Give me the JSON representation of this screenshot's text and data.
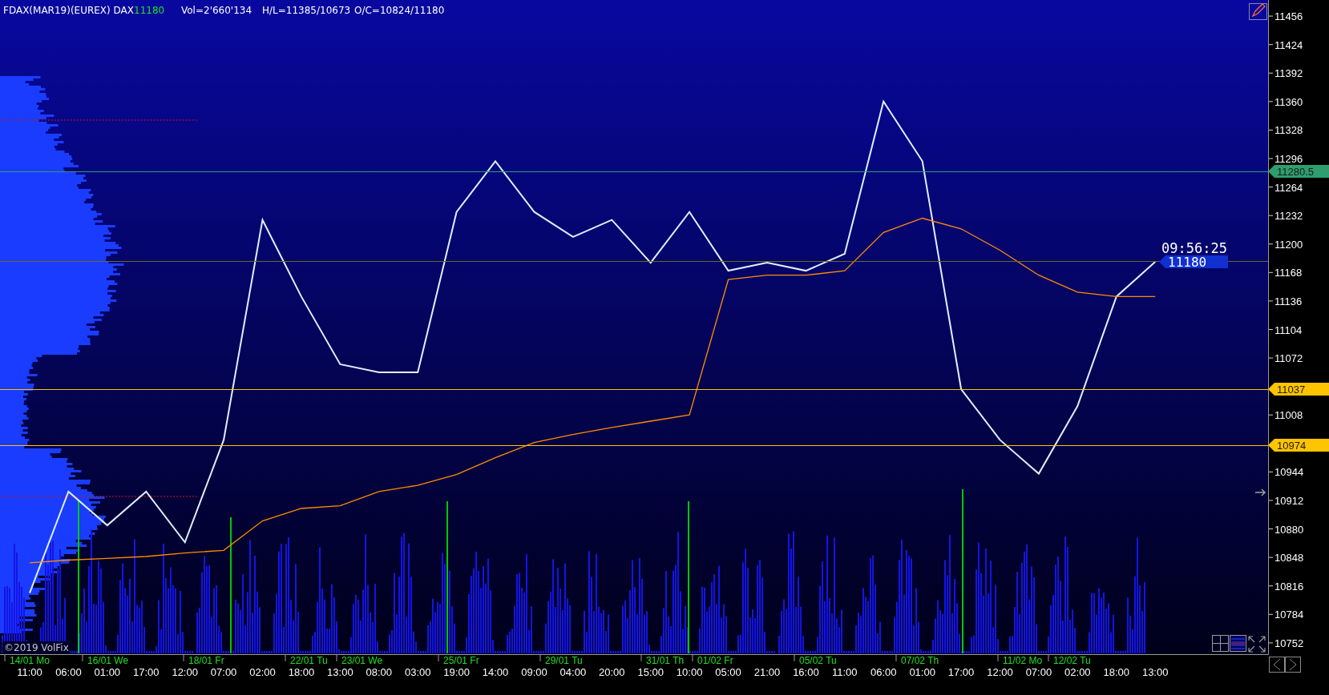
{
  "header": {
    "symbol": "FDAX(MAR19)(EUREX) DAX",
    "last": "11180",
    "volume": "Vol=2'660'134",
    "high_low": "H/L=11385/10673",
    "open_close": "O/C=10824/11180"
  },
  "chart_data": {
    "type": "line",
    "x": [
      "11:00",
      "06:00",
      "01:00",
      "17:00",
      "12:00",
      "07:00",
      "02:00",
      "18:00",
      "13:00",
      "08:00",
      "03:00",
      "19:00",
      "14:00",
      "09:00",
      "04:00",
      "20:00",
      "15:00",
      "10:00",
      "05:00",
      "21:00",
      "16:00",
      "11:00",
      "06:00",
      "01:00",
      "17:00",
      "12:00",
      "07:00",
      "02:00",
      "18:00",
      "13:00"
    ],
    "series": [
      {
        "color": "#dfefff",
        "values": [
          10808,
          10922,
          10884,
          10922,
          10865,
          10980,
          11227,
          11141,
          11065,
          11056,
          11056,
          11236,
          11293,
          11236,
          11208,
          11227,
          11179,
          11236,
          11170,
          11179,
          11170,
          11189,
          11360,
          11293,
          11037,
          10980,
          10942,
          11018,
          11141,
          11180
        ]
      },
      {
        "color": "#ff8c00",
        "values": [
          10842,
          10845,
          10847,
          10849,
          10853,
          10856,
          10889,
          10903,
          10906,
          10922,
          10929,
          10941,
          10960,
          10977,
          10986,
          10994,
          11001,
          11008,
          11160,
          11165,
          11165,
          11170,
          11213,
          11229,
          11217,
          11193,
          11165,
          11146,
          11141,
          11141
        ]
      }
    ],
    "ylim": [
      10736,
      11472
    ],
    "yticks": [
      11456,
      11424,
      11392,
      11360,
      11328,
      11296,
      11264,
      11232,
      11200,
      11168,
      11136,
      11104,
      11072,
      11008,
      10944,
      10912,
      10880,
      10848,
      10816,
      10784,
      10752
    ]
  },
  "price_levels": [
    {
      "label": "11280.5",
      "color": "#2e9e6e"
    },
    {
      "color": "#6b6b1e"
    },
    {
      "label": "11037",
      "color": "#ffc400"
    },
    {
      "label": "10974",
      "color": "#ffc400"
    }
  ],
  "date_labels": [
    "14/01 Mo",
    "16/01 We",
    "18/01 Fr",
    "22/01 Tu",
    "23/01 We",
    "25/01 Fr",
    "29/01 Tu",
    "31/01 Th",
    "01/02 Fr",
    "05/02 Tu",
    "07/02 Th",
    "11/02 Mo",
    "12/02 Tu"
  ],
  "price_tag": {
    "time": "09:56:25",
    "price": "11180"
  },
  "copyright": "©2019 VolFix"
}
